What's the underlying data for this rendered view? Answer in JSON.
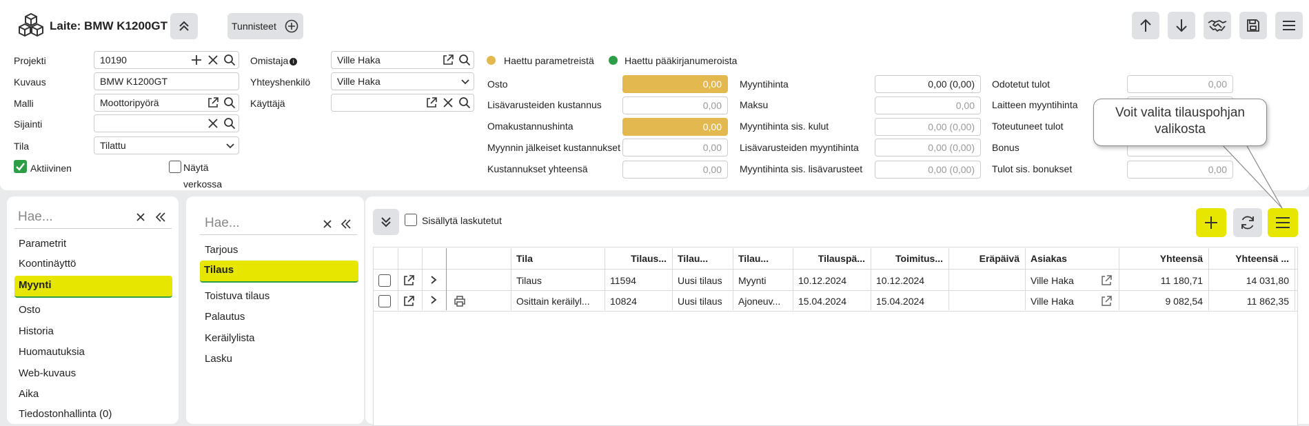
{
  "header": {
    "title": "Laite: BMW K1200GT",
    "tags_label": "Tunnisteet"
  },
  "form": {
    "projekti": {
      "label": "Projekti",
      "value": "10190"
    },
    "kuvaus": {
      "label": "Kuvaus",
      "value": "BMW K1200GT"
    },
    "malli": {
      "label": "Malli",
      "value": "Moottoripyörä"
    },
    "sijainti": {
      "label": "Sijainti",
      "value": ""
    },
    "tila": {
      "label": "Tila",
      "value": "Tilattu"
    },
    "aktiivinen": {
      "label": "Aktiivinen",
      "checked": true
    },
    "nayta_verkossa": {
      "label_line1": "Näytä",
      "label_line2": "verkossa",
      "checked": false
    },
    "omistaja": {
      "label": "Omistaja",
      "value": "Ville Haka"
    },
    "yhteyshenkilo": {
      "label": "Yhteyshenkilö",
      "value": "Ville Haka"
    },
    "kayttaja": {
      "label": "Käyttäjä",
      "value": ""
    }
  },
  "legend": {
    "params": {
      "label": "Haettu parametreistä",
      "color": "#e3b94f"
    },
    "ledger": {
      "label": "Haettu pääkirjanumeroista",
      "color": "#2e9e46"
    }
  },
  "costs": [
    {
      "label": "Osto",
      "value": "0,00",
      "style": "gold"
    },
    {
      "label": "Lisävarusteiden kustannus",
      "value": "0,00",
      "style": "plain"
    },
    {
      "label": "Omakustannushinta",
      "value": "0,00",
      "style": "gold"
    },
    {
      "label": "Myynnin jälkeiset kustannukset",
      "value": "0,00",
      "style": "plain"
    },
    {
      "label": "Kustannukset yhteensä",
      "value": "0,00",
      "style": "plain"
    }
  ],
  "prices": [
    {
      "label": "Myyntihinta",
      "value": "0,00 (0,00)",
      "style": "dark"
    },
    {
      "label": "Maksu",
      "value": "0,00",
      "style": "plain"
    },
    {
      "label": "Myyntihinta sis. kulut",
      "value": "0,00 (0,00)",
      "style": "plain"
    },
    {
      "label": "Lisävarusteiden myyntihinta",
      "value": "0,00 (0,00)",
      "style": "plain"
    },
    {
      "label": "Myyntihinta sis. lisävarusteet",
      "value": "0,00 (0,00)",
      "style": "plain"
    }
  ],
  "incomes": [
    {
      "label": "Odotetut tulot",
      "value": "0,00"
    },
    {
      "label": "Laitteen myyntihinta",
      "value": ""
    },
    {
      "label": "Toteutuneet tulot",
      "value": ""
    },
    {
      "label": "Bonus",
      "value": ""
    },
    {
      "label": "Tulot sis. bonukset",
      "value": "0,00"
    }
  ],
  "tooltip": {
    "line1": "Voit valita tilauspohjan",
    "line2": "valikosta"
  },
  "left_nav": {
    "search_placeholder": "Hae...",
    "items": [
      "Parametrit",
      "Koontinäyttö",
      "Myynti",
      "Osto",
      "Historia",
      "Huomautuksia",
      "Web-kuvaus",
      "Aika",
      "Tiedostonhallinta (0)"
    ]
  },
  "sub_nav": {
    "search_placeholder": "Hae...",
    "items": [
      "Tarjous",
      "Tilaus",
      "Toistuva tilaus",
      "Palautus",
      "Keräilylista",
      "Lasku"
    ]
  },
  "toolbar": {
    "include_invoiced_label": "Sisällytä laskutetut"
  },
  "table": {
    "columns": [
      "Tila",
      "Tilaus...",
      "Tilau...",
      "Tilau...",
      "Tilauspä...",
      "Toimitus...",
      "Eräpäivä",
      "Asiakas",
      "Yhteensä",
      "Yhteensä ..."
    ],
    "rows": [
      [
        "Tilaus",
        "11594",
        "Uusi tilaus",
        "Myynti",
        "10.12.2024",
        "10.12.2024",
        "",
        "Ville Haka",
        "11 180,71",
        "14 031,80"
      ],
      [
        "Osittain keräilyl...",
        "10824",
        "Uusi tilaus",
        "Ajoneuv...",
        "15.04.2024",
        "15.04.2024",
        "",
        "Ville Haka",
        "9 082,54",
        "11 862,35"
      ]
    ]
  }
}
